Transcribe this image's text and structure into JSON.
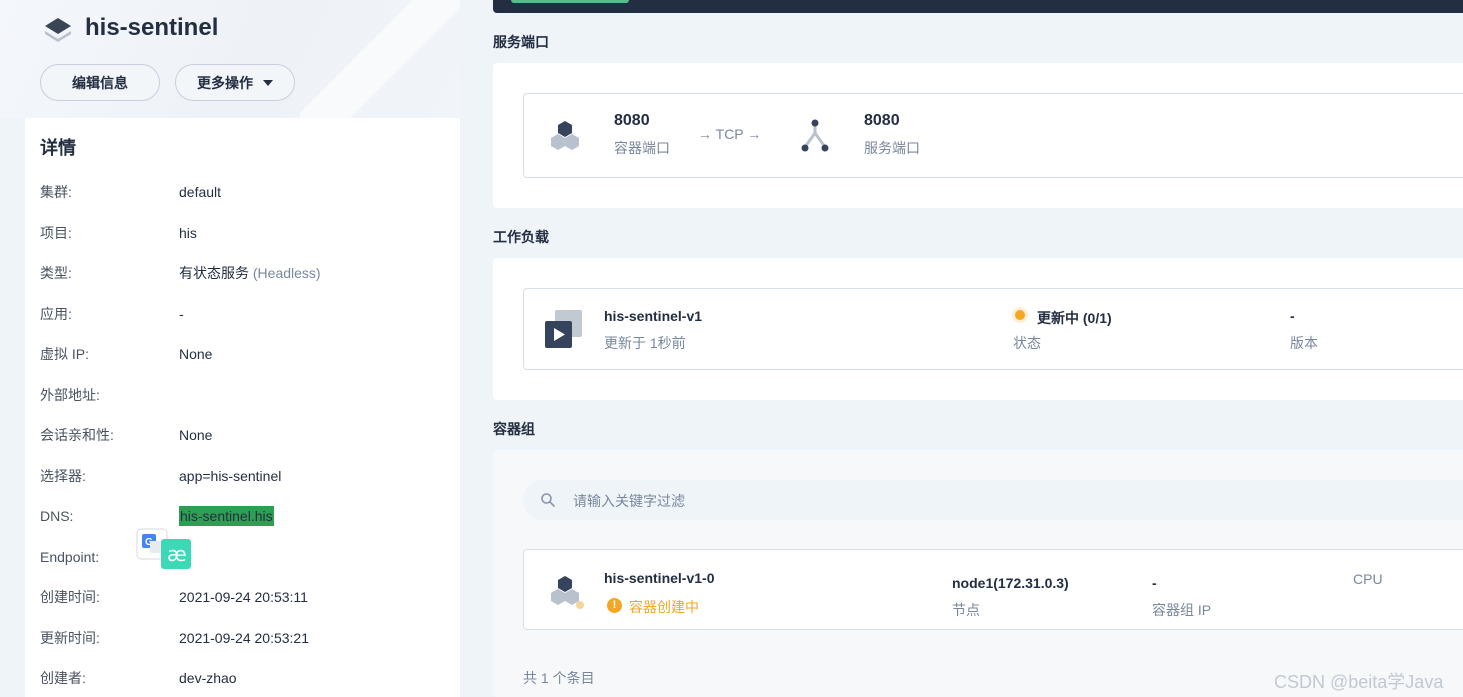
{
  "header": {
    "title": "his-sentinel",
    "edit_button": "编辑信息",
    "more_button": "更多操作"
  },
  "details": {
    "title": "详情",
    "rows": [
      {
        "key": "集群:",
        "value": "default"
      },
      {
        "key": "项目:",
        "value": "his"
      },
      {
        "key": "类型:",
        "value": "有状态服务",
        "value_muted": "(Headless)"
      },
      {
        "key": "应用:",
        "value": "-"
      },
      {
        "key": "虚拟 IP:",
        "value": "None"
      },
      {
        "key": "外部地址:",
        "value": ""
      },
      {
        "key": "会话亲和性:",
        "value": "None"
      },
      {
        "key": "选择器:",
        "value": "app=his-sentinel"
      },
      {
        "key": "DNS:",
        "value": "his-sentinel.his"
      },
      {
        "key": "Endpoint:",
        "value": ""
      },
      {
        "key": "创建时间:",
        "value": "2021-09-24 20:53:11"
      },
      {
        "key": "更新时间:",
        "value": "2021-09-24 20:53:21"
      },
      {
        "key": "创建者:",
        "value": "dev-zhao"
      }
    ]
  },
  "ports": {
    "section_title": "服务端口",
    "container_port": "8080",
    "container_port_label": "容器端口",
    "protocol": "→ TCP →",
    "service_port": "8080",
    "service_port_label": "服务端口"
  },
  "workloads": {
    "section_title": "工作负载",
    "name": "his-sentinel-v1",
    "updated": "更新于 1秒前",
    "status": "更新中 (0/1)",
    "status_label": "状态",
    "version": "-",
    "version_label": "版本"
  },
  "pods": {
    "section_title": "容器组",
    "search_placeholder": "请输入关键字过滤",
    "name": "his-sentinel-v1-0",
    "state": "容器创建中",
    "node": "node1(172.31.0.3)",
    "node_label": "节点",
    "pod_ip": "-",
    "pod_ip_label": "容器组 IP",
    "cpu_label": "CPU",
    "total": "共 1 个条目"
  },
  "watermark": "CSDN @beita学Java",
  "colors": {
    "accent_green": "#55bc8a",
    "dark": "#242e42",
    "warning": "#f5a623",
    "highlight": "#2e9e53"
  }
}
